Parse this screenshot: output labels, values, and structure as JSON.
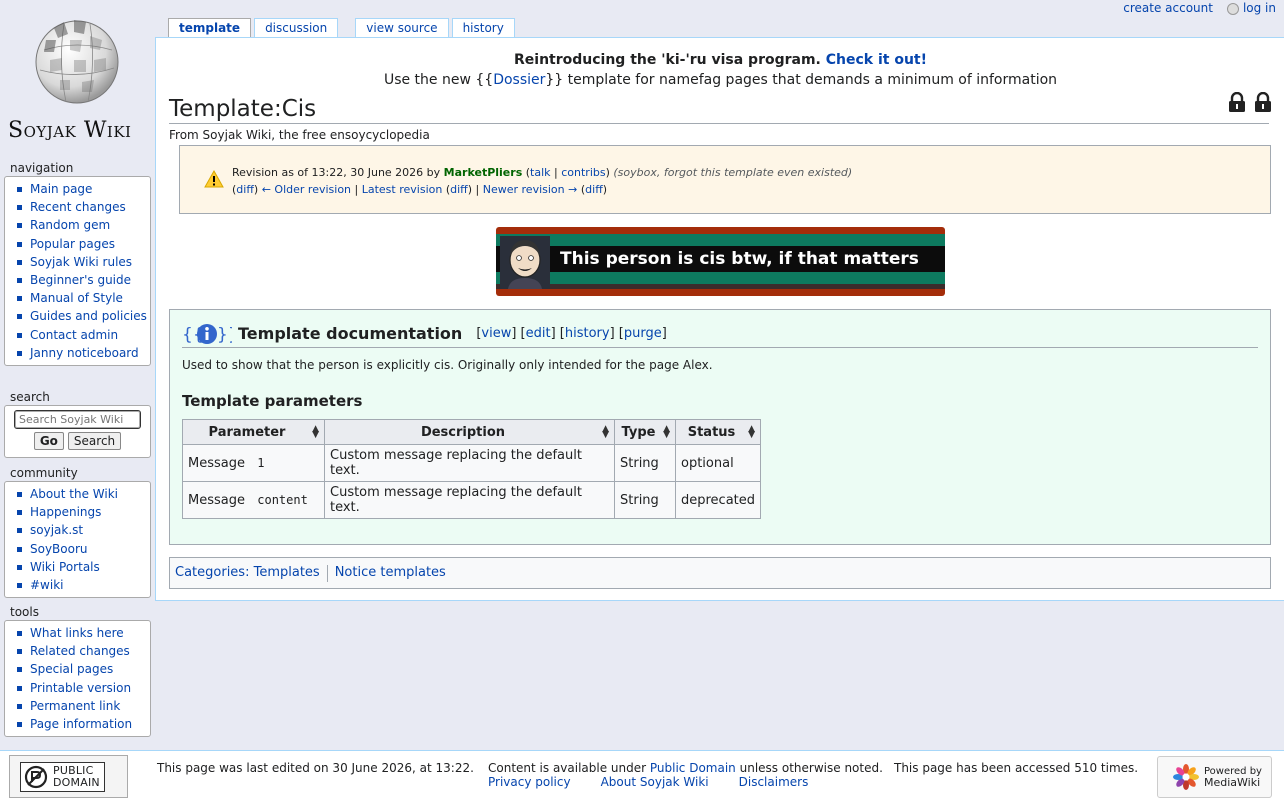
{
  "site": {
    "wordmark": "Soyjak Wiki"
  },
  "personal": {
    "create_account": "create account",
    "log_in": "log in"
  },
  "tabs": [
    {
      "label": "template",
      "selected": true
    },
    {
      "label": "discussion"
    },
    {
      "label": "view source"
    },
    {
      "label": "history"
    }
  ],
  "notice": {
    "line1_text": "Reintroducing the 'ki-'ru visa program.",
    "line1_link": "Check it out!",
    "line2_pre": "Use the new {{",
    "line2_link": "Dossier",
    "line2_post": "}} template for namefag pages that demands a minimum of information"
  },
  "page": {
    "title": "Template:Cis",
    "tagline": "From Soyjak Wiki, the free ensoycyclopedia"
  },
  "revision": {
    "prefix": "Revision as of 13:22, 30 June 2026 by",
    "user": "MarketPliers",
    "talk": "talk",
    "contribs": "contribs",
    "summary": "(soybox, forgot this template even existed)",
    "diff1": "diff",
    "older": "← Older revision",
    "latest": "Latest revision",
    "diff2": "diff",
    "newer": "Newer revision →",
    "diff3": "diff"
  },
  "banner": {
    "text": "This person is cis btw, if that matters"
  },
  "doc": {
    "title": "Template documentation",
    "links": {
      "view": "view",
      "edit": "edit",
      "history": "history",
      "purge": "purge"
    },
    "description": "Used to show that the person is explicitly cis. Originally only intended for the page Alex.",
    "params_heading": "Template parameters",
    "table": {
      "headers": [
        "Parameter",
        "Description",
        "Type",
        "Status"
      ],
      "rows": [
        {
          "label": "Message",
          "param": "1",
          "description": "Custom message replacing the default text.",
          "type": "String",
          "status": "optional"
        },
        {
          "label": "Message",
          "param": "content",
          "description": "Custom message replacing the default text.",
          "type": "String",
          "status": "deprecated"
        }
      ]
    }
  },
  "categories": {
    "label": "Categories",
    "items": [
      "Templates",
      "Notice templates"
    ]
  },
  "sidebar": {
    "navigation": {
      "heading": "navigation",
      "items": [
        "Main page",
        "Recent changes",
        "Random gem",
        "Popular pages",
        "Soyjak Wiki rules",
        "Beginner's guide",
        "Manual of Style",
        "Guides and policies",
        "Contact admin",
        "Janny noticeboard"
      ]
    },
    "search": {
      "heading": "search",
      "placeholder": "Search Soyjak Wiki",
      "go": "Go",
      "search": "Search"
    },
    "community": {
      "heading": "community",
      "items": [
        "About the Wiki",
        "Happenings",
        "soyjak.st",
        "SoyBooru",
        "Wiki Portals",
        "#wiki"
      ]
    },
    "tools": {
      "heading": "tools",
      "items": [
        "What links here",
        "Related changes",
        "Special pages",
        "Printable version",
        "Permanent link",
        "Page information"
      ]
    }
  },
  "footer": {
    "pd_line1": "PUBLIC",
    "pd_line2": "DOMAIN",
    "last_edited": "This page was last edited on 30 June 2026, at 13:22.",
    "content_pre": "Content is available under",
    "content_link": "Public Domain",
    "content_post": "unless otherwise noted.",
    "links": [
      "Privacy policy",
      "About Soyjak Wiki",
      "Disclaimers"
    ],
    "accessed": "This page has been accessed 510 times.",
    "powered_line1": "Powered by",
    "powered_line2": "MediaWiki"
  }
}
